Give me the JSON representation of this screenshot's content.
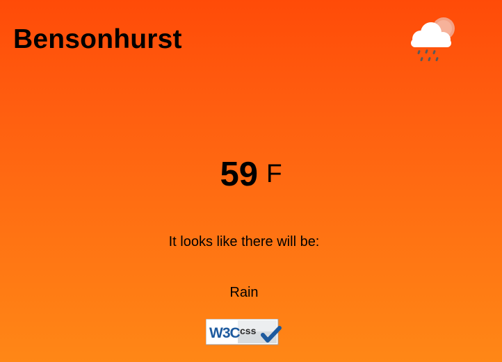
{
  "location": {
    "city": "Bensonhurst"
  },
  "weather": {
    "icon": "cloud-rain-sun-icon",
    "temperature": "59",
    "unit": "F",
    "intro": "It looks like there will be:",
    "condition": "Rain"
  },
  "badge": {
    "icon": "w3c-css-valid-badge",
    "w3c_text": "W3C",
    "css_text": "css"
  },
  "colors": {
    "background_top": "#ff4b08",
    "background_bottom": "#ff8716",
    "text": "#000000",
    "badge_blue": "#1d5a9e"
  }
}
